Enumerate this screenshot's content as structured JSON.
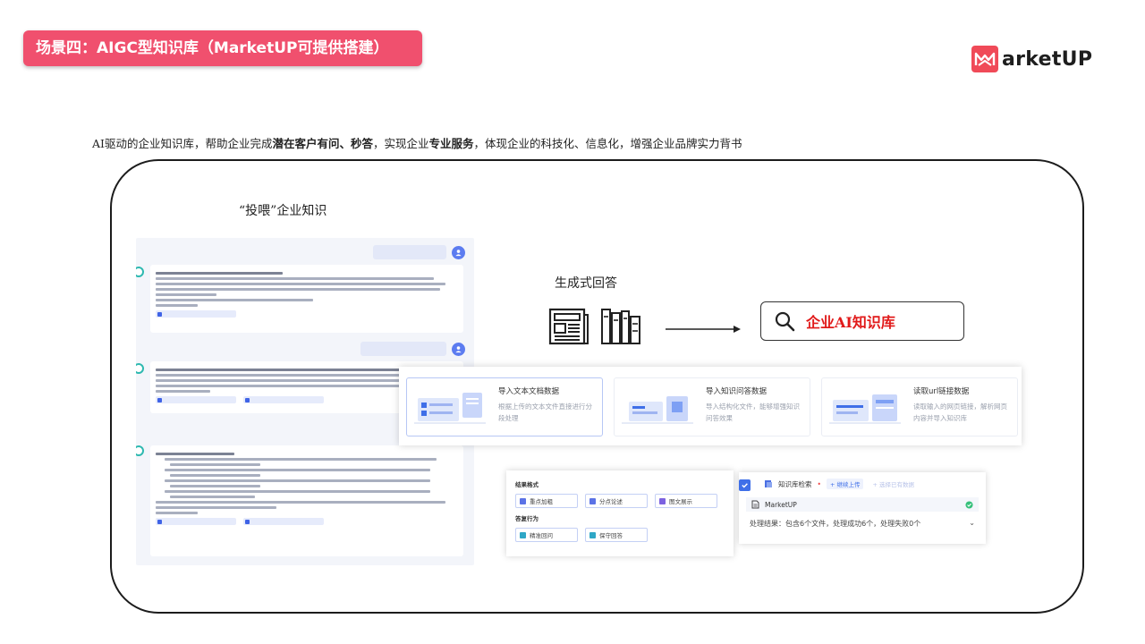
{
  "header": {
    "title": "场景四：AIGC型知识库（MarketUP可提供搭建）",
    "logo_text": "arketUP",
    "brand_color": "#f0506e"
  },
  "intro": {
    "part1": "AI驱动的企业知识库，帮助企业完成",
    "bold1": "潜在客户有问、秒答",
    "part2": "，实现企业",
    "bold2": "专业服务",
    "part3": "，体现企业的科技化、信息化，增强企业品牌实力背书"
  },
  "diagram": {
    "left_caption": "“投喂”企业知识",
    "mid_caption": "生成式回答",
    "kb_label": "企业AI知识库",
    "kb_label_color": "#e11a1a"
  },
  "import_cards": [
    {
      "title": "导入文本文档数据",
      "desc": "根据上传的文本文件直接进行分段处理"
    },
    {
      "title": "导入知识问答数据",
      "desc": "导入结构化文件，能够增强知识问答效果"
    },
    {
      "title": "读取url链接数据",
      "desc": "读取输入的网页链接，解析网页内容并导入知识库"
    }
  ],
  "settings": {
    "format_title": "结果格式",
    "format_options": [
      "重点加粗",
      "分点论述",
      "图文展示"
    ],
    "behavior_title": "答复行为",
    "behavior_options": [
      "精准回问",
      "保守回答"
    ]
  },
  "kb_panel": {
    "title": "知识库检索",
    "continue_upload": "+ 继续上传",
    "select_uploaded": "+ 选择已有数据",
    "file_name": "MarketUP",
    "result": "处理结果：包含6个文件，处理成功6个，处理失败0个"
  }
}
